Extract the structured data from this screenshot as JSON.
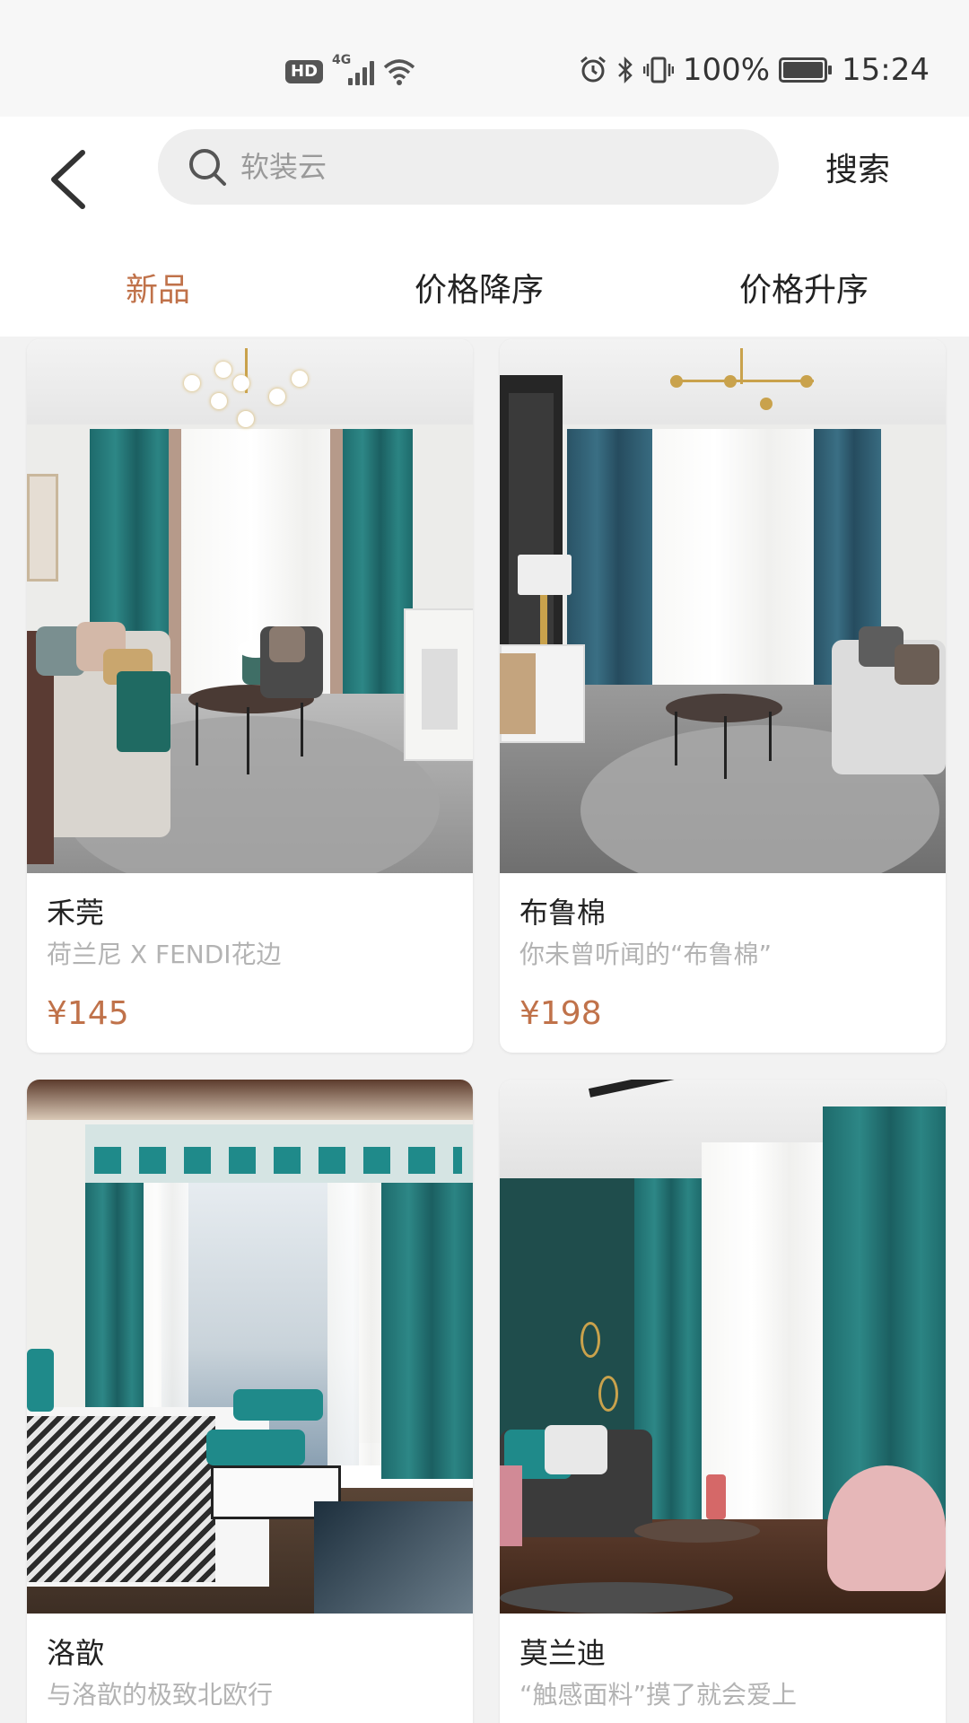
{
  "status_bar": {
    "hd": "HD",
    "network": "4G",
    "battery_percent": "100%",
    "time": "15:24"
  },
  "header": {
    "search_placeholder": "软装云",
    "search_button": "搜索"
  },
  "sort_tabs": [
    {
      "label": "新品",
      "active": true
    },
    {
      "label": "价格降序",
      "active": false
    },
    {
      "label": "价格升序",
      "active": false
    }
  ],
  "products": [
    {
      "title": "禾莞",
      "subtitle": "荷兰尼 X FENDI花边",
      "price": "¥145"
    },
    {
      "title": "布鲁棉",
      "subtitle": "你未曾听闻的“布鲁棉”",
      "price": "¥198"
    },
    {
      "title": "洛歆",
      "subtitle": "与洛歆的极致北欧行",
      "price": ""
    },
    {
      "title": "莫兰迪",
      "subtitle": "“触感面料”摸了就会爱上",
      "price": ""
    }
  ],
  "colors": {
    "accent": "#c0724a",
    "subtitle": "#b3b3b3",
    "background": "#f2f2f2"
  },
  "icons": [
    "back-arrow-icon",
    "search-icon",
    "alarm-icon",
    "bluetooth-icon",
    "vibrate-icon",
    "battery-icon",
    "wifi-icon",
    "signal-icon"
  ]
}
